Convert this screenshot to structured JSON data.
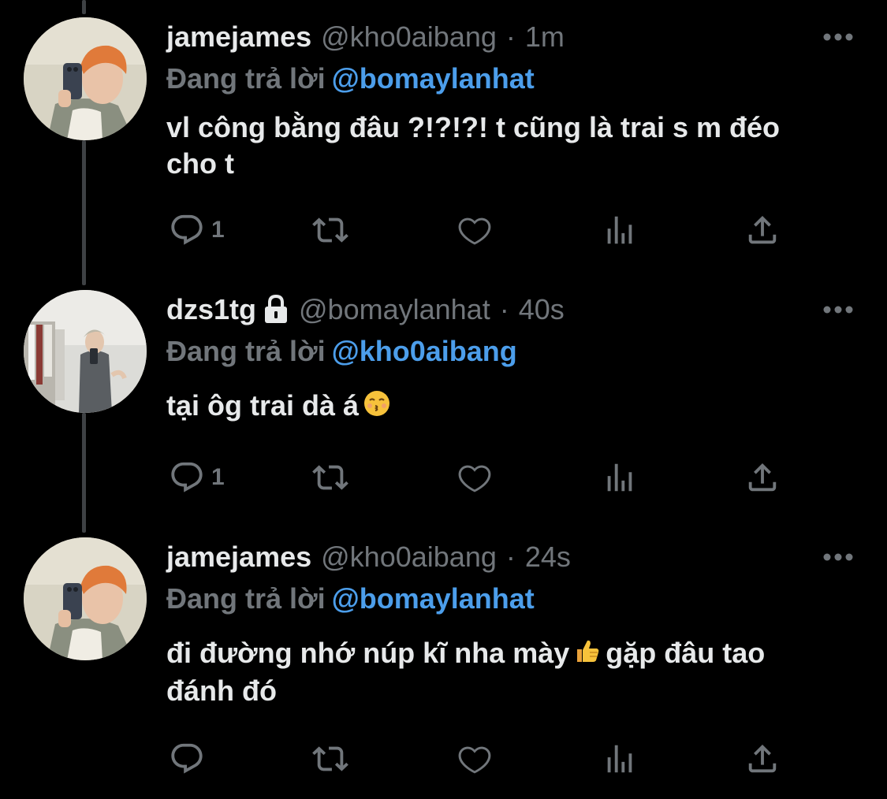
{
  "thread": {
    "tweets": [
      {
        "display_name": "jamejames",
        "handle": "@kho0aibang",
        "separator": "·",
        "time": "1m",
        "locked": false,
        "reply_prefix": "Đang trả lời",
        "reply_to": "@bomaylanhat",
        "text_lines": [
          "vl công bằng đâu ?!?!?! t cũng là trai s m đéo",
          "cho t"
        ],
        "reply_count": "1",
        "avatar_icon": "avatar-selfie-orange-hair"
      },
      {
        "display_name": "dzs1tg",
        "handle": "@bomaylanhat",
        "separator": "·",
        "time": "40s",
        "locked": true,
        "reply_prefix": "Đang trả lời",
        "reply_to": "@kho0aibang",
        "text_before_emoji": "tại ôg trai dà á",
        "emoji": "kissing-face-emoji",
        "reply_count": "1",
        "avatar_icon": "avatar-mirror-selfie-room"
      },
      {
        "display_name": "jamejames",
        "handle": "@kho0aibang",
        "separator": "·",
        "time": "24s",
        "locked": false,
        "reply_prefix": "Đang trả lời",
        "reply_to": "@bomaylanhat",
        "text_line1_before_emoji": "đi đường nhớ núp kĩ nha mày",
        "emoji": "thumbs-up-emoji",
        "text_line1_after_emoji": "gặp đâu tao",
        "text_line2": "đánh đó",
        "reply_count": "",
        "avatar_icon": "avatar-selfie-orange-hair"
      }
    ]
  },
  "colors": {
    "background": "#000000",
    "text": "#e7e9ea",
    "secondary": "#71767b",
    "mention": "#4c9eeb",
    "thread_line": "#3e4144"
  },
  "icons": [
    "reply-icon",
    "retweet-icon",
    "like-icon",
    "views-icon",
    "share-icon",
    "more-icon",
    "lock-icon"
  ]
}
